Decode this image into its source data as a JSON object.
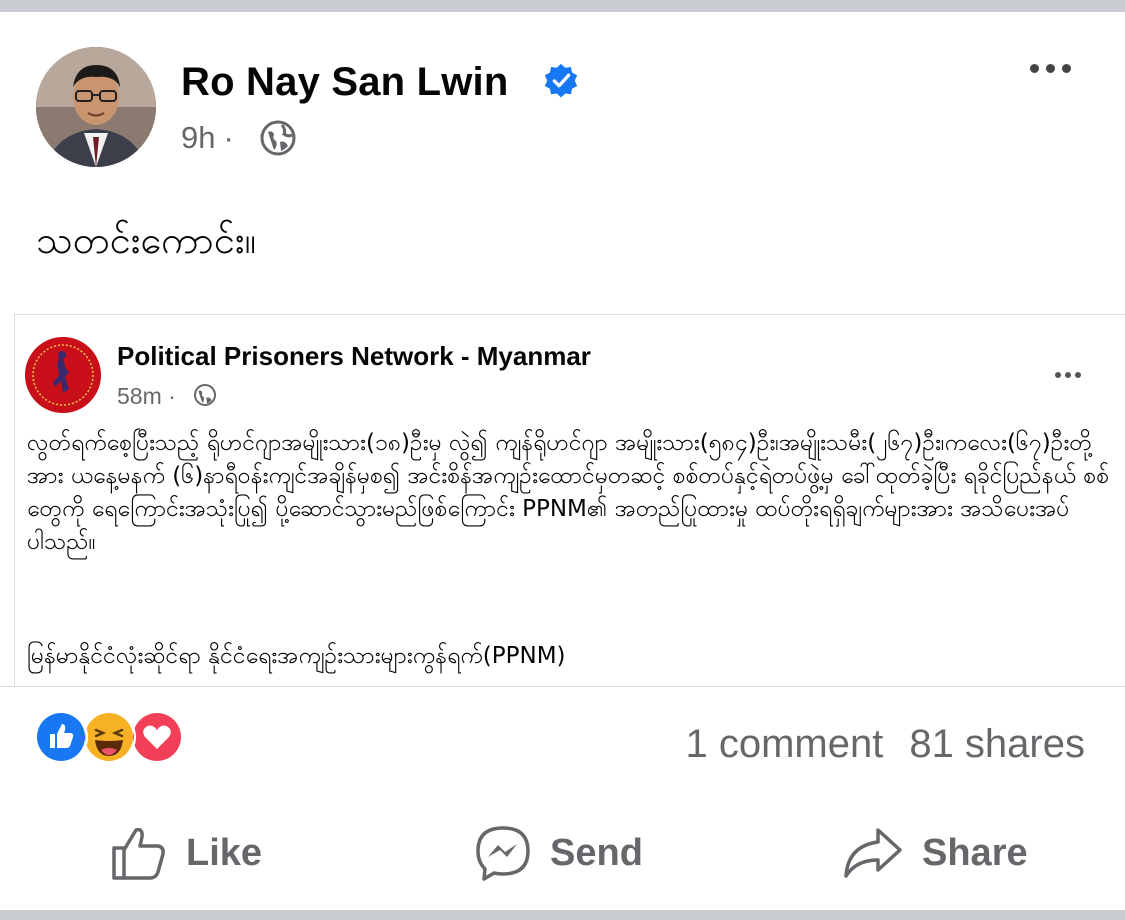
{
  "post": {
    "author_name": "Ro Nay San Lwin",
    "timestamp": "9h",
    "separator": "·",
    "text": "သတင်းကောင်း။"
  },
  "shared_post": {
    "page_name": "Political Prisoners Network - Myanmar",
    "timestamp": "58m",
    "separator": "·",
    "body": "လွတ်ရက်စေ့ပြီးသည့် ရိုဟင်ဂျာအမျိုးသား(၁၈)ဦးမှ လွဲ၍ ကျန်ရိုဟင်ဂျာ အမျိုးသား(၅၈၄)ဦး၊အမျိုးသမီး(၂၆၇)ဦး၊ကလေး(၆၇)ဦးတို့အား ယနေ့မနက် (၆)နာရီဝန်းကျင်အချိန်မှစ၍ အင်းစိန်အကျဉ်းထောင်မှတဆင့် စစ်တပ်နှင့်ရဲတပ်ဖွဲ့မှ ခေါ်ထုတ်ခဲ့ပြီး ရခိုင်ပြည်နယ် စစ်တွေကို ရေကြောင်းအသုံးပြု၍ ပို့ဆောင်သွားမည်ဖြစ်ကြောင်း PPNM၏ အတည်ပြုထားမှု ထပ်တိုးရရှိချက်များအား အသိပေးအပ်ပါသည်။",
    "signature": "မြန်မာနိုင်ငံလုံးဆိုင်ရာ နိုင်ငံရေးအကျဉ်းသားများကွန်ရက်(PPNM)"
  },
  "engagement": {
    "comments": "1 comment",
    "shares": "81 shares",
    "reactions": [
      "like-reaction",
      "haha-reaction",
      "love-reaction"
    ]
  },
  "actions": {
    "like": "Like",
    "send": "Send",
    "share": "Share"
  },
  "colors": {
    "verified": "#1877f2",
    "like_reaction": "#1877f2",
    "haha_reaction": "#f7b125",
    "love_reaction": "#f33e58",
    "secondary_text": "#65676b",
    "page_logo": "#c9101a"
  }
}
